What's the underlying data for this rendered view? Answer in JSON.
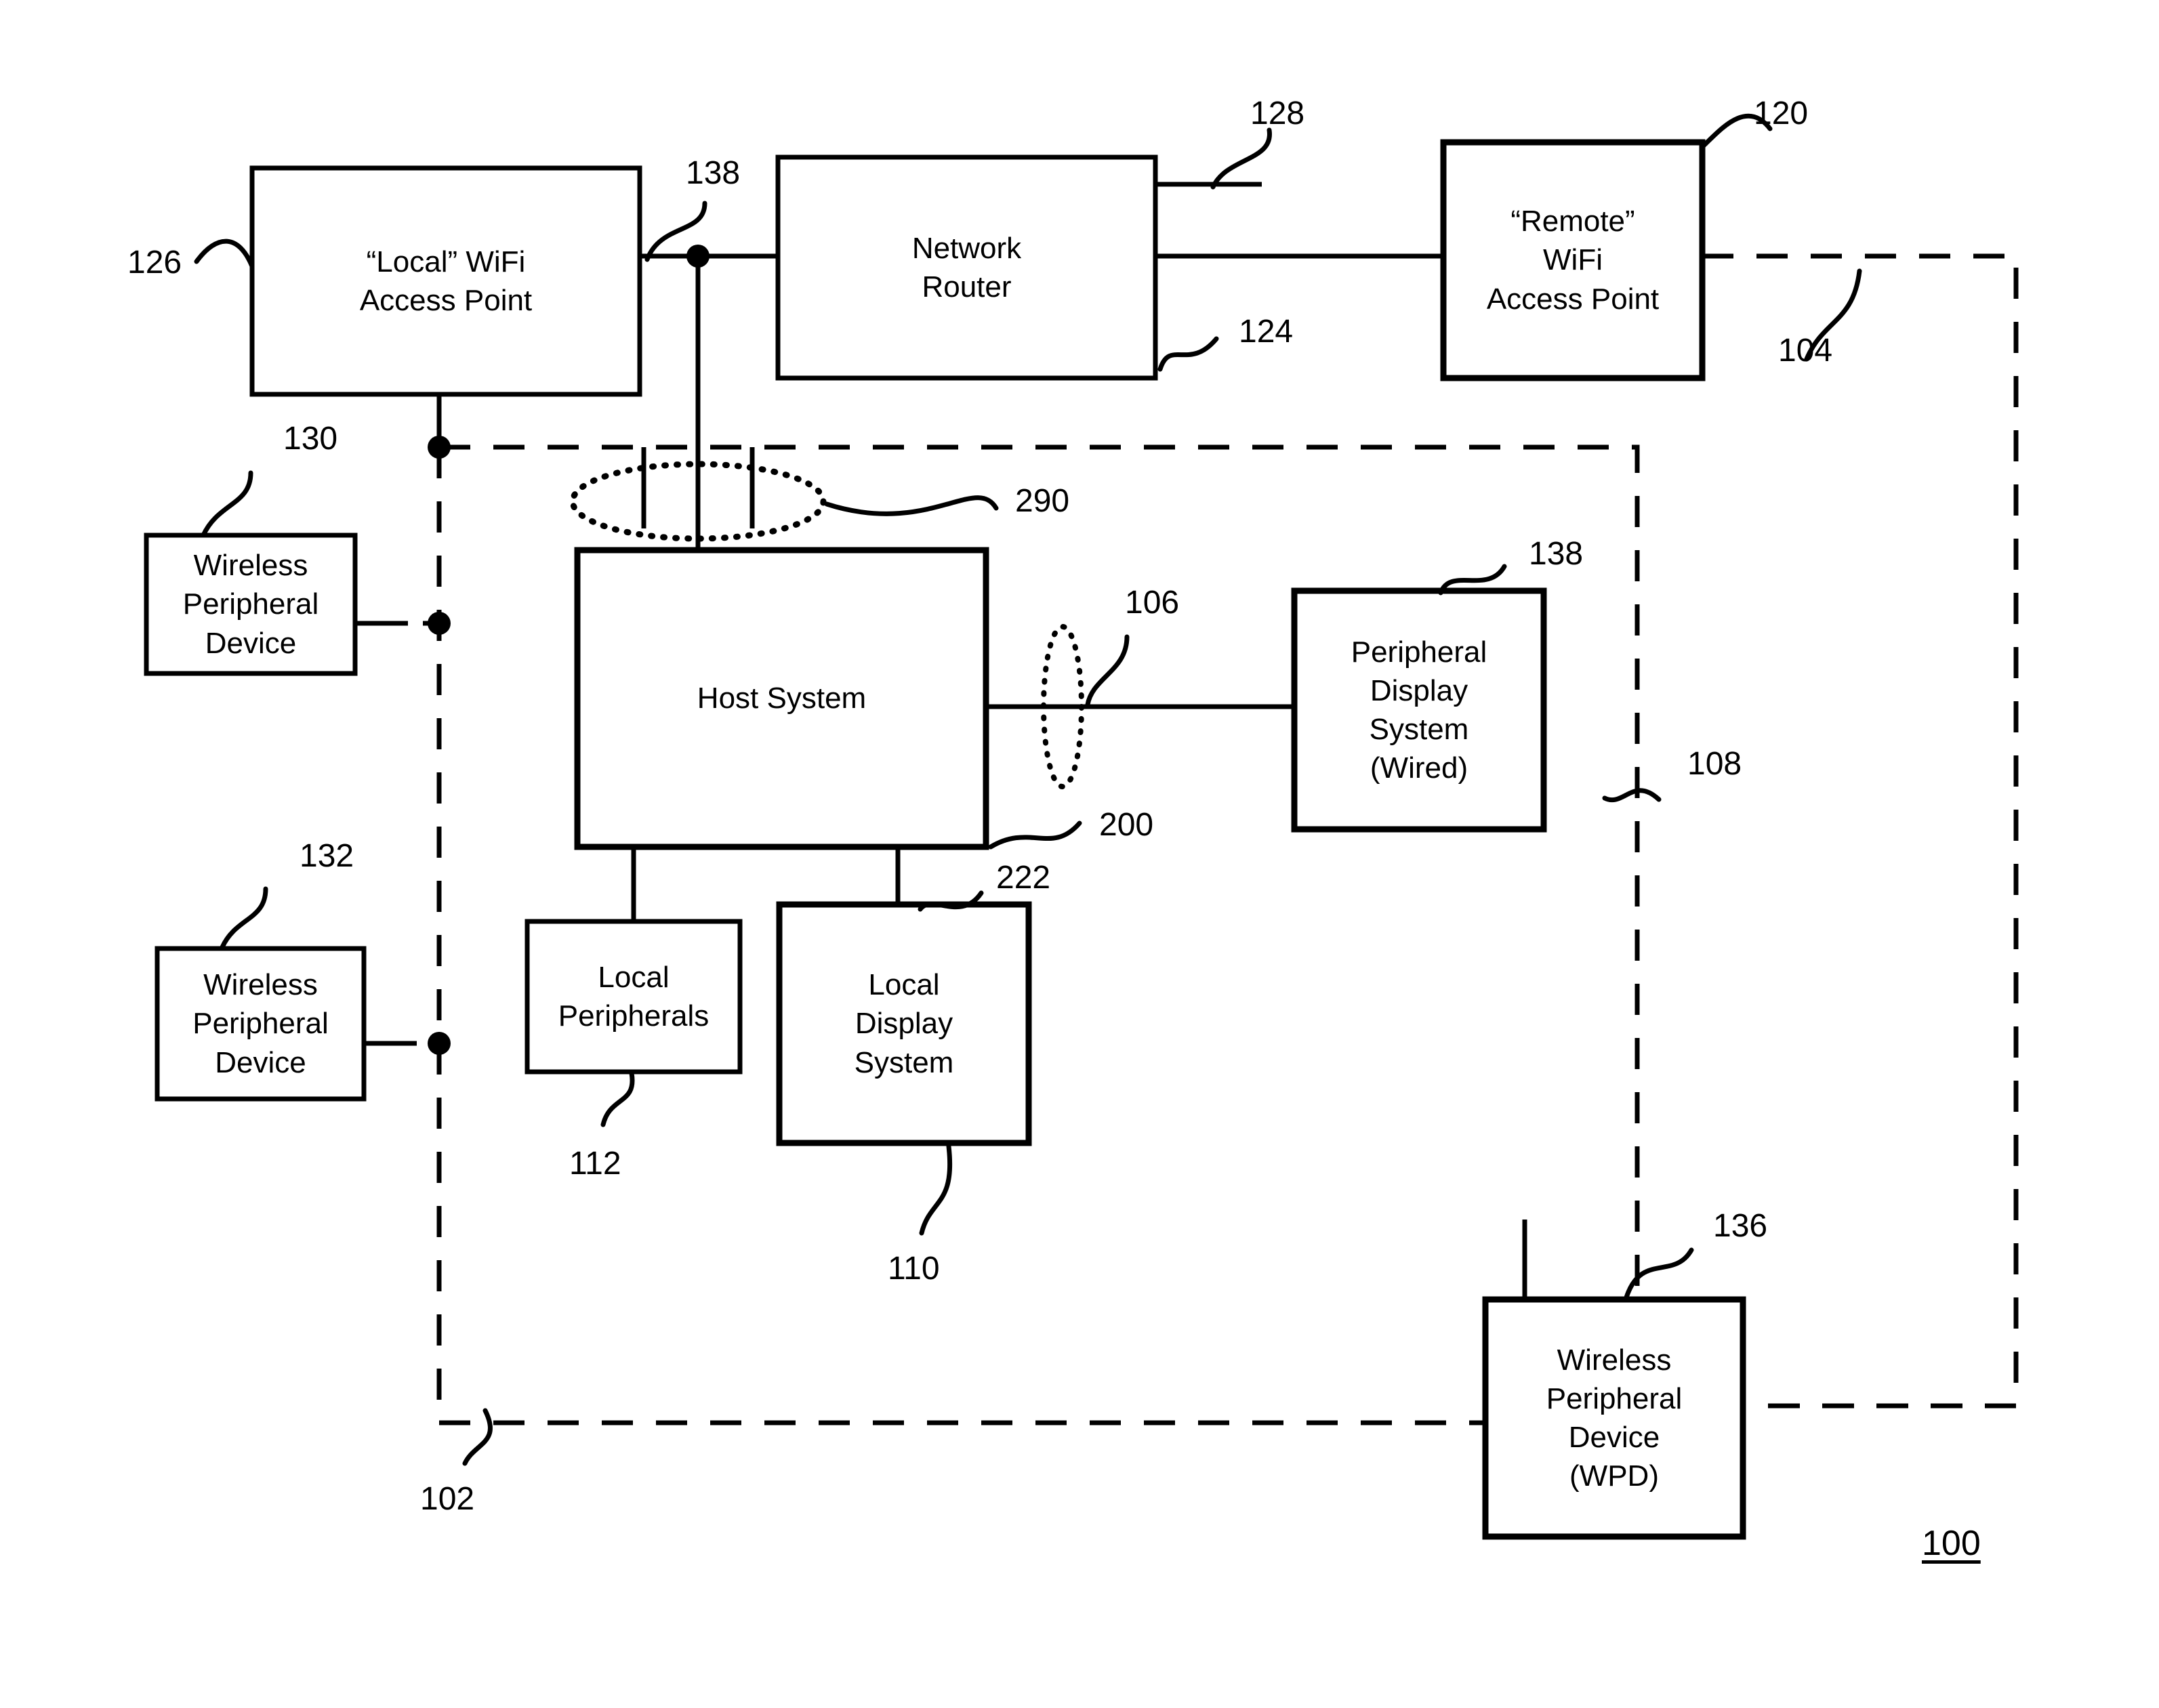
{
  "figure": {
    "figure_number": "100",
    "boxes": [
      {
        "id": "local_ap",
        "label": "“Local” WiFi\nAccess Point"
      },
      {
        "id": "router",
        "label": "Network\nRouter"
      },
      {
        "id": "remote_ap",
        "label": "“Remote”\nWiFi\nAccess Point"
      },
      {
        "id": "wpd_130",
        "label": "Wireless\nPeripheral\nDevice"
      },
      {
        "id": "wpd_132",
        "label": "Wireless\nPeripheral\nDevice"
      },
      {
        "id": "host",
        "label": "Host System"
      },
      {
        "id": "periph_disp",
        "label": "Peripheral\nDisplay\nSystem\n(Wired)"
      },
      {
        "id": "local_periph",
        "label": "Local\nPeripherals"
      },
      {
        "id": "local_disp",
        "label": "Local\nDisplay\nSystem"
      },
      {
        "id": "wpd_136",
        "label": "Wireless\nPeripheral\nDevice\n(WPD)"
      }
    ],
    "reference_numerals": [
      {
        "id": "n126",
        "text": "126"
      },
      {
        "id": "n138a",
        "text": "138"
      },
      {
        "id": "n128",
        "text": "128"
      },
      {
        "id": "n124",
        "text": "124"
      },
      {
        "id": "n120",
        "text": "120"
      },
      {
        "id": "n104",
        "text": "104"
      },
      {
        "id": "n130",
        "text": "130"
      },
      {
        "id": "n290",
        "text": "290"
      },
      {
        "id": "n106",
        "text": "106"
      },
      {
        "id": "n138b",
        "text": "138"
      },
      {
        "id": "n108",
        "text": "108"
      },
      {
        "id": "n200",
        "text": "200"
      },
      {
        "id": "n132",
        "text": "132"
      },
      {
        "id": "n222",
        "text": "222"
      },
      {
        "id": "n112",
        "text": "112"
      },
      {
        "id": "n110",
        "text": "110"
      },
      {
        "id": "n136",
        "text": "136"
      },
      {
        "id": "n102",
        "text": "102"
      },
      {
        "id": "n100",
        "text": "100"
      }
    ]
  }
}
